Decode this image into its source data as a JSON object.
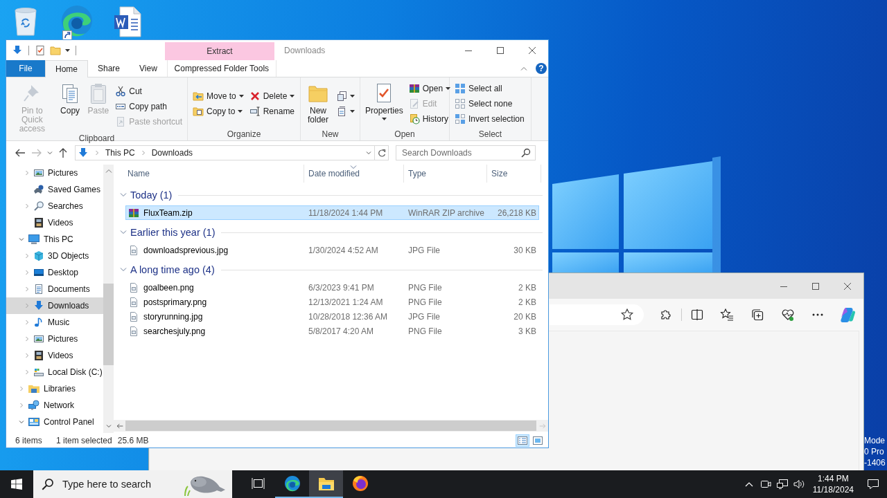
{
  "desktop": {
    "shortcuts": [
      {
        "kind": "recycle-bin",
        "shortcut": false
      },
      {
        "kind": "browser",
        "shortcut": true
      },
      {
        "kind": "document",
        "shortcut": false
      }
    ],
    "edition_text": [
      "Mode",
      "0 Pro",
      "-1406"
    ]
  },
  "explorer": {
    "context_group": "Extract",
    "title": "Downloads",
    "help_glyph": "?",
    "tabs": [
      {
        "label": "File",
        "kind": "file",
        "selected": false
      },
      {
        "label": "Home",
        "kind": "tab",
        "selected": true
      },
      {
        "label": "Share",
        "kind": "tab",
        "selected": false
      },
      {
        "label": "View",
        "kind": "tab",
        "selected": false
      },
      {
        "label": "Compressed Folder Tools",
        "kind": "context",
        "selected": false
      }
    ],
    "ribbon": {
      "groups": [
        {
          "name": "Clipboard",
          "items": [
            {
              "kind": "large",
              "label": "Pin to Quick access",
              "disabled": true,
              "dropdown": false
            },
            {
              "kind": "large",
              "label": "Copy",
              "disabled": false,
              "dropdown": false
            },
            {
              "kind": "large",
              "label": "Paste",
              "disabled": true,
              "dropdown": false
            },
            {
              "kind": "column",
              "items": [
                {
                  "label": "Cut",
                  "disabled": false,
                  "dropdown": false
                },
                {
                  "label": "Copy path",
                  "disabled": false,
                  "dropdown": false
                },
                {
                  "label": "Paste shortcut",
                  "disabled": true,
                  "dropdown": false
                }
              ]
            }
          ]
        },
        {
          "name": "Organize",
          "items": [
            {
              "kind": "column",
              "items": [
                {
                  "label": "Move to",
                  "disabled": false,
                  "dropdown": true
                },
                {
                  "label": "Copy to",
                  "disabled": false,
                  "dropdown": true
                }
              ]
            },
            {
              "kind": "column",
              "items": [
                {
                  "label": "Delete",
                  "disabled": false,
                  "dropdown": true
                },
                {
                  "label": "Rename",
                  "disabled": false,
                  "dropdown": false
                }
              ]
            }
          ]
        },
        {
          "name": "New",
          "items": [
            {
              "kind": "large",
              "label": "New folder",
              "disabled": false,
              "dropdown": false
            },
            {
              "kind": "column",
              "items": [
                {
                  "disabled": false,
                  "dropdown": true
                },
                {
                  "disabled": false,
                  "dropdown": true
                }
              ]
            }
          ]
        },
        {
          "name": "Open",
          "items": [
            {
              "kind": "large",
              "label": "Properties",
              "disabled": false,
              "dropdown": true
            },
            {
              "kind": "column",
              "items": [
                {
                  "label": "Open",
                  "disabled": false,
                  "dropdown": true
                },
                {
                  "label": "Edit",
                  "disabled": true,
                  "dropdown": false
                },
                {
                  "label": "History",
                  "disabled": false,
                  "dropdown": false
                }
              ]
            }
          ]
        },
        {
          "name": "Select",
          "items": [
            {
              "kind": "column",
              "items": [
                {
                  "label": "Select all",
                  "disabled": false,
                  "dropdown": false
                },
                {
                  "label": "Select none",
                  "disabled": false,
                  "dropdown": false
                },
                {
                  "label": "Invert selection",
                  "disabled": false,
                  "dropdown": false
                }
              ]
            }
          ]
        }
      ]
    },
    "address": {
      "crumbs": [
        "This PC",
        "Downloads"
      ]
    },
    "search": {
      "placeholder": "Search Downloads"
    },
    "navigation": {
      "continued_items": [
        {
          "label": "Pictures",
          "kind": "pictures",
          "expandable": true,
          "expanded": false,
          "selected": false
        },
        {
          "label": "Saved Games",
          "kind": "games",
          "expandable": false,
          "expanded": false,
          "selected": false
        },
        {
          "label": "Searches",
          "kind": "search",
          "expandable": true,
          "expanded": false,
          "selected": false
        },
        {
          "label": "Videos",
          "kind": "videos",
          "expandable": false,
          "expanded": false,
          "selected": false
        }
      ],
      "items": [
        {
          "label": "This PC",
          "kind": "pc",
          "expandable": true,
          "expanded": true,
          "selected": false,
          "children": [
            {
              "label": "3D Objects",
              "kind": "cube",
              "expandable": true,
              "expanded": false,
              "selected": false
            },
            {
              "label": "Desktop",
              "kind": "desktop",
              "expandable": true,
              "expanded": false,
              "selected": false
            },
            {
              "label": "Documents",
              "kind": "documents",
              "expandable": true,
              "expanded": false,
              "selected": false
            },
            {
              "label": "Downloads",
              "kind": "downloads",
              "expandable": true,
              "expanded": false,
              "selected": true
            },
            {
              "label": "Music",
              "kind": "music",
              "expandable": true,
              "expanded": false,
              "selected": false
            },
            {
              "label": "Pictures",
              "kind": "pictures",
              "expandable": true,
              "expanded": false,
              "selected": false
            },
            {
              "label": "Videos",
              "kind": "videos",
              "expandable": true,
              "expanded": false,
              "selected": false
            },
            {
              "label": "Local Disk (C:)",
              "kind": "disk",
              "expandable": true,
              "expanded": false,
              "selected": false
            }
          ]
        },
        {
          "label": "Libraries",
          "kind": "libraries",
          "expandable": true,
          "expanded": false,
          "selected": false
        },
        {
          "label": "Network",
          "kind": "network",
          "expandable": true,
          "expanded": false,
          "selected": false
        },
        {
          "label": "Control Panel",
          "kind": "control-panel",
          "expandable": true,
          "expanded": true,
          "selected": false
        }
      ]
    },
    "columns": [
      {
        "label": "Name",
        "sorted": false
      },
      {
        "label": "Date modified",
        "sorted": true
      },
      {
        "label": "Type",
        "sorted": false
      },
      {
        "label": "Size",
        "sorted": false
      }
    ],
    "groups": [
      {
        "title": "Today (1)",
        "expanded": true,
        "files": [
          {
            "name": "FluxTeam.zip",
            "kind": "archive",
            "date": "11/18/2024 1:44 PM",
            "type": "WinRAR ZIP archive",
            "size": "26,218 KB",
            "selected": true
          }
        ]
      },
      {
        "title": "Earlier this year (1)",
        "expanded": true,
        "files": [
          {
            "name": "downloadsprevious.jpg",
            "kind": "image",
            "date": "1/30/2024 4:52 AM",
            "type": "JPG File",
            "size": "30 KB",
            "selected": false
          }
        ]
      },
      {
        "title": "A long time ago (4)",
        "expanded": true,
        "files": [
          {
            "name": "goalbeen.png",
            "kind": "image",
            "date": "6/3/2023 9:41 PM",
            "type": "PNG File",
            "size": "2 KB",
            "selected": false
          },
          {
            "name": "postsprimary.png",
            "kind": "image",
            "date": "12/13/2021 1:24 AM",
            "type": "PNG File",
            "size": "2 KB",
            "selected": false
          },
          {
            "name": "storyrunning.jpg",
            "kind": "image",
            "date": "10/28/2018 12:36 AM",
            "type": "JPG File",
            "size": "20 KB",
            "selected": false
          },
          {
            "name": "searchesjuly.png",
            "kind": "image",
            "date": "5/8/2017 4:20 AM",
            "type": "PNG File",
            "size": "3 KB",
            "selected": false
          }
        ]
      }
    ],
    "status": {
      "count": "6 items",
      "selection": "1 item selected",
      "selection_size": "25.6 MB"
    },
    "views": [
      {
        "kind": "details",
        "selected": true
      },
      {
        "kind": "large-icons",
        "selected": false
      }
    ]
  },
  "taskbar": {
    "search_placeholder": "Type here to search",
    "apps": [
      {
        "kind": "task-view",
        "running": false,
        "active": false
      },
      {
        "kind": "browser",
        "running": true,
        "active": false
      },
      {
        "kind": "folder",
        "running": true,
        "active": true
      },
      {
        "kind": "firefox",
        "running": false,
        "active": false
      }
    ],
    "time": "1:44 PM",
    "date": "11/18/2024"
  }
}
